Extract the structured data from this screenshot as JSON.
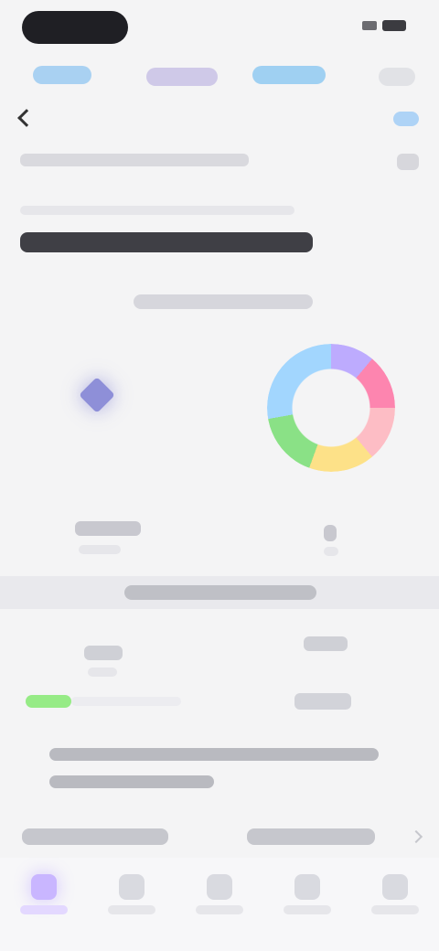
{
  "app": {
    "title": "",
    "top_tabs": [
      "",
      "",
      "",
      ""
    ],
    "bottom_nav": [
      "",
      "",
      "",
      "",
      ""
    ]
  },
  "colors": {
    "background": "#f4f4f5",
    "accent_purple": "#8e8fd8",
    "accent_blue": "#9fd0f2",
    "accent_green": "#96eb86"
  },
  "icons": {
    "back": "chevron-left-icon",
    "cloud": "cloud-icon",
    "more": "more-dots-icon",
    "diamond": "diamond-icon",
    "ring": "ring-icon",
    "nav_home": "home-icon"
  }
}
